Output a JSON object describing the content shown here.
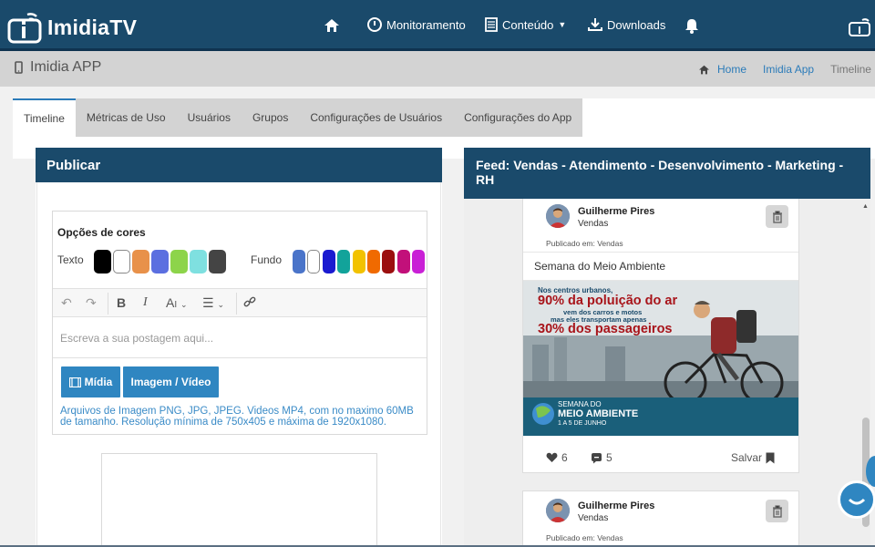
{
  "brand": {
    "name": "ImidiaTV"
  },
  "nav": [
    {
      "label": "",
      "icon": "home-icon"
    },
    {
      "label": "Monitoramento",
      "icon": "dashboard-icon"
    },
    {
      "label": "Conteúdo",
      "icon": "document-icon",
      "dropdown": true
    },
    {
      "label": "Downloads",
      "icon": "download-icon"
    },
    {
      "label": "",
      "icon": "bell-icon"
    }
  ],
  "app": {
    "title": "Imidia APP"
  },
  "breadcrumb": [
    "Home",
    "Imidia App",
    "Timeline"
  ],
  "tabs": [
    "Timeline",
    "Métricas de Uso",
    "Usuários",
    "Grupos",
    "Configurações de Usuários",
    "Configurações do App"
  ],
  "publish": {
    "title": "Publicar",
    "colors_label": "Opções de cores",
    "text_label": "Texto",
    "bg_label": "Fundo",
    "text_colors": [
      "#000000",
      "#ffffff",
      "#e8914a",
      "#5b6fe0",
      "#8dd44a",
      "#7fe0e0",
      "#444444"
    ],
    "bg_colors": [
      "#4a74c9",
      "#ffffff",
      "#1a1ad0",
      "#12a39a",
      "#f2c200",
      "#f06a00",
      "#9b0f0f",
      "#c2107a",
      "#c920d6"
    ],
    "placeholder": "Escreva a sua postagem aqui...",
    "btn_midia": "Mídia",
    "btn_imagem": "Imagem / Vídeo",
    "hint": "Arquivos de Imagem PNG, JPG, JPEG. Videos MP4, com no maximo 60MB de tamanho. Resolução mínima de 750x405 e máxima de 1920x1080."
  },
  "feed": {
    "title": "Feed: Vendas - Atendimento - Desenvolvimento - Marketing - RH",
    "posts": [
      {
        "author": "Guilherme Pires",
        "group": "Vendas",
        "published_in": "Publicado em: Vendas",
        "title": "Semana do Meio Ambiente",
        "image_lines": [
          "Nos centros urbanos,",
          "90% da poluição do ar",
          "vem dos carros e motos",
          "mas eles transportam apenas",
          "30% dos passageiros",
          "SEMANA DO",
          "MEIO AMBIENTE",
          "1 A 5 DE JUNHO"
        ],
        "likes": "6",
        "comments": "5",
        "save": "Salvar"
      },
      {
        "author": "Guilherme Pires",
        "group": "Vendas",
        "published_in": "Publicado em: Vendas"
      }
    ]
  },
  "colors": {
    "primary": "#1a4a6b",
    "accent": "#2f86c1"
  }
}
